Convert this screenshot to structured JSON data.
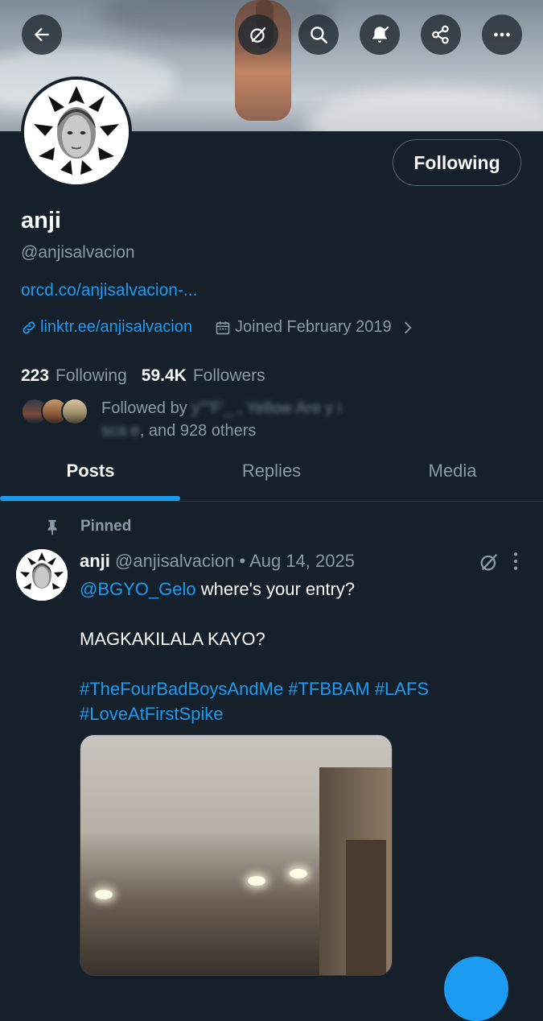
{
  "header": {
    "buttons": {
      "back": "back-arrow-icon",
      "grok": "grok-icon",
      "search": "search-icon",
      "notifications": "bell-check-icon",
      "share": "share-icon",
      "more": "more-icon"
    }
  },
  "profile": {
    "name": "anji",
    "handle": "@anjisalvacion",
    "bio_link": "orcd.co/anjisalvacion-...",
    "website": "linktr.ee/anjisalvacion",
    "joined": "Joined February 2019",
    "following_button": "Following",
    "stats": {
      "following_count": "223",
      "following_label": "Following",
      "followers_count": "59.4K",
      "followers_label": "Followers"
    },
    "followed_by": {
      "prefix": "Followed by",
      "suffix": ", and 928 others"
    }
  },
  "tabs": [
    {
      "label": "Posts",
      "active": true
    },
    {
      "label": "Replies",
      "active": false
    },
    {
      "label": "Media",
      "active": false
    }
  ],
  "post": {
    "pinned_label": "Pinned",
    "author_name": "anji",
    "author_handle": "@anjisalvacion",
    "separator": "•",
    "date": "Aug 14, 2025",
    "mention": "@BGYO_Gelo",
    "line1_rest": " where's your entry?",
    "line2": "MAGKAKILALA KAYO?",
    "hashtags_line1": "#TheFourBadBoysAndMe #TFBBAM #LAFS",
    "hashtags_line2": "#LoveAtFirstSpike"
  },
  "colors": {
    "background": "#15202b",
    "accent": "#1d9bf0",
    "muted": "#8b98a5",
    "text": "#f7f9f9"
  }
}
